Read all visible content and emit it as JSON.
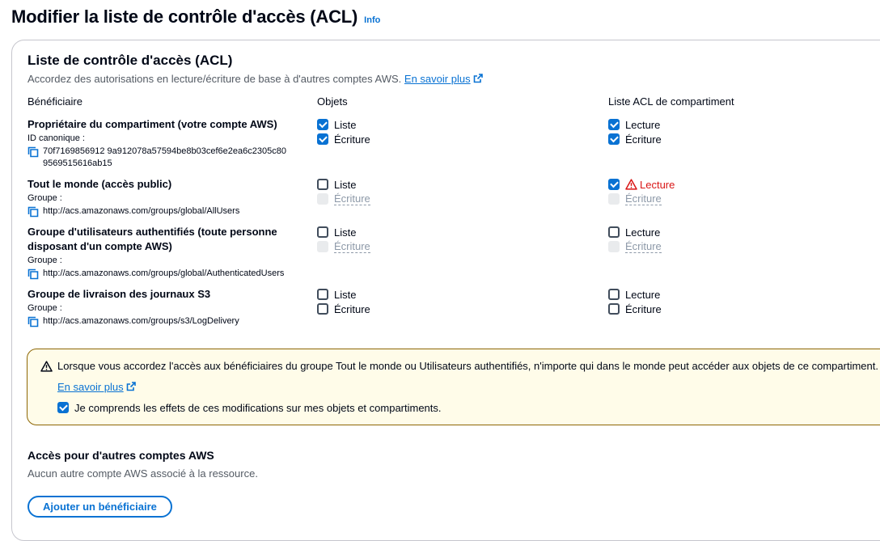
{
  "page": {
    "title": "Modifier la liste de contrôle d'accès (ACL)",
    "info": "Info"
  },
  "panel": {
    "title": "Liste de contrôle d'accès (ACL)",
    "description": "Accordez des autorisations en lecture/écriture de base à d'autres comptes AWS.",
    "learn_more": "En savoir plus",
    "columns": {
      "grantee": "Bénéficiaire",
      "objects": "Objets",
      "bucket_acl": "Liste ACL de compartiment"
    },
    "grantees": [
      {
        "name": "Propriétaire du compartiment (votre compte AWS)",
        "id_label": "ID canonique :",
        "id_value": "70f7169856912 9a912078a57594be8b03cef6e2ea6c2305c809569515616ab15",
        "objects": [
          {
            "label": "Liste",
            "checked": true,
            "disabled": false
          },
          {
            "label": "Écriture",
            "checked": true,
            "disabled": false
          }
        ],
        "bucket": [
          {
            "label": "Lecture",
            "checked": true,
            "disabled": false,
            "warning": false
          },
          {
            "label": "Écriture",
            "checked": true,
            "disabled": false,
            "warning": false
          }
        ]
      },
      {
        "name": "Tout le monde (accès public)",
        "id_label": "Groupe :",
        "id_value": "http://acs.amazonaws.com/groups/global/AllUsers",
        "objects": [
          {
            "label": "Liste",
            "checked": false,
            "disabled": false
          },
          {
            "label": "Écriture",
            "checked": false,
            "disabled": true
          }
        ],
        "bucket": [
          {
            "label": "Lecture",
            "checked": true,
            "disabled": false,
            "warning": true
          },
          {
            "label": "Écriture",
            "checked": false,
            "disabled": true,
            "warning": false
          }
        ]
      },
      {
        "name": "Groupe d'utilisateurs authentifiés (toute personne disposant d'un compte AWS)",
        "id_label": "Groupe :",
        "id_value": "http://acs.amazonaws.com/groups/global/AuthenticatedUsers",
        "objects": [
          {
            "label": "Liste",
            "checked": false,
            "disabled": false
          },
          {
            "label": "Écriture",
            "checked": false,
            "disabled": true
          }
        ],
        "bucket": [
          {
            "label": "Lecture",
            "checked": false,
            "disabled": false,
            "warning": false
          },
          {
            "label": "Écriture",
            "checked": false,
            "disabled": true,
            "warning": false
          }
        ]
      },
      {
        "name": "Groupe de livraison des journaux S3",
        "id_label": "Groupe :",
        "id_value": "http://acs.amazonaws.com/groups/s3/LogDelivery",
        "objects": [
          {
            "label": "Liste",
            "checked": false,
            "disabled": false
          },
          {
            "label": "Écriture",
            "checked": false,
            "disabled": false
          }
        ],
        "bucket": [
          {
            "label": "Lecture",
            "checked": false,
            "disabled": false,
            "warning": false
          },
          {
            "label": "Écriture",
            "checked": false,
            "disabled": false,
            "warning": false
          }
        ]
      }
    ],
    "alert": {
      "text": "Lorsque vous accordez l'accès aux bénéficiaires du groupe Tout le monde ou Utilisateurs authentifiés, n'importe qui dans le monde peut accéder aux objets de ce compartiment.",
      "learn_more": "En savoir plus",
      "ack_label": "Je comprends les effets de ces modifications sur mes objets et compartiments.",
      "ack_checked": true
    },
    "other_accounts": {
      "title": "Accès pour d'autres comptes AWS",
      "description": "Aucun autre compte AWS associé à la ressource.",
      "add_button": "Ajouter un bénéficiaire"
    }
  },
  "colors": {
    "link": "#0972d3",
    "warning": "#d91515",
    "alert_bg": "#fffce9",
    "alert_border": "#8d6605",
    "checkbox_on": "#0972d3"
  },
  "icons": {
    "external": "external-link-icon",
    "copy": "copy-icon",
    "warning": "warning-icon"
  }
}
